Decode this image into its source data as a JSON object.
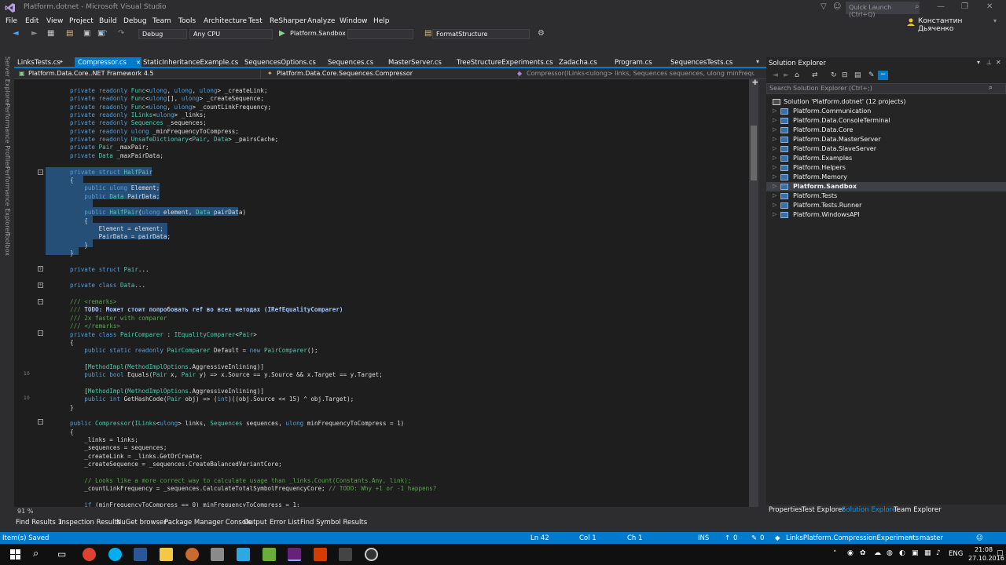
{
  "window": {
    "title": "Platform.dotnet - Microsoft Visual Studio",
    "quick_launch": "Quick Launch (Ctrl+Q)",
    "user": "Константин Дьяченко"
  },
  "menu": [
    "File",
    "Edit",
    "View",
    "Project",
    "Build",
    "Debug",
    "Team",
    "Tools",
    "Architecture",
    "Test",
    "ReSharper",
    "Analyze",
    "Window",
    "Help"
  ],
  "toolbar": {
    "config": "Debug",
    "platform": "Any CPU",
    "start": "Platform.Sandbox",
    "format": "FormatStructure"
  },
  "left_strip": [
    "Server Explorer",
    "Performance Profiler",
    "Performance Explorer",
    "Toolbox"
  ],
  "tabs": [
    {
      "label": "LinksTests.cs",
      "active": false
    },
    {
      "label": "Compressor.cs",
      "active": true
    },
    {
      "label": "StaticInheritanceExample.cs",
      "active": false
    },
    {
      "label": "SequencesOptions.cs",
      "active": false
    },
    {
      "label": "Sequences.cs",
      "active": false
    },
    {
      "label": "MasterServer.cs",
      "active": false
    },
    {
      "label": "TreeStructureExperiments.cs",
      "active": false
    },
    {
      "label": "Zadacha.cs",
      "active": false
    },
    {
      "label": "Program.cs",
      "active": false
    },
    {
      "label": "SequencesTests.cs",
      "active": false
    }
  ],
  "navbar": {
    "project": "Platform.Data.Core..NET Framework 4.5",
    "type": "Platform.Data.Core.Sequences.Compressor",
    "member": "Compressor(ILinks<ulong> links, Sequences sequences, ulong minFrequencyToCo"
  },
  "code": {
    "lines": [
      "private readonly Func<ulong, ulong, ulong> _createLink;",
      "private readonly Func<ulong[], ulong> _createSequence;",
      "private readonly Func<ulong, ulong> _countLinkFrequency;",
      "private readonly ILinks<ulong> _links;",
      "private readonly Sequences _sequences;",
      "private readonly ulong _minFrequencyToCompress;",
      "private readonly UnsafeDictionary<Pair, Data> _pairsCache;",
      "private Pair _maxPair;",
      "private Data _maxPairData;",
      "",
      "private struct HalfPair",
      "{",
      "    public ulong Element;",
      "    public Data PairData;",
      "",
      "    public HalfPair(ulong element, Data pairData)",
      "    {",
      "        Element = element;",
      "        PairData = pairData;",
      "    }",
      "}",
      "",
      "private struct Pair...",
      "",
      "private class Data...",
      "",
      "/// <remarks>",
      "/// TODO: Может стоит попробовать ref во всех методах (IRefEqualityComparer)",
      "/// 2x faster with comparer",
      "/// </remarks>",
      "private class PairComparer : IEqualityComparer<Pair>",
      "{",
      "    public static readonly PairComparer Default = new PairComparer();",
      "",
      "    [MethodImpl(MethodImplOptions.AggressiveInlining)]",
      "    public bool Equals(Pair x, Pair y) => x.Source == y.Source && x.Target == y.Target;",
      "",
      "    [MethodImpl(MethodImplOptions.AggressiveInlining)]",
      "    public int GetHashCode(Pair obj) => (int)((obj.Source << 15) ^ obj.Target);",
      "}",
      "",
      "public Compressor(ILinks<ulong> links, Sequences sequences, ulong minFrequencyToCompress = 1)",
      "{",
      "    _links = links;",
      "    _sequences = sequences;",
      "    _createLink = _links.GetOrCreate;",
      "    _createSequence = _sequences.CreateBalancedVariantCore;",
      "",
      "    // Looks like a more correct way to calculate usage than _links.Count(Constants.Any, link);",
      "    _countLinkFrequency = _sequences.CalculateTotalSymbolFrequencyCore; // TODO: Why +1 or -1 happens?",
      "",
      "    if (minFrequencyToCompress == 0) minFrequencyToCompress = 1;"
    ]
  },
  "zoom": "91 %",
  "solution_explorer": {
    "title": "Solution Explorer",
    "search_placeholder": "Search Solution Explorer (Ctrl+;)",
    "solution": "Solution 'Platform.dotnet' (12 projects)",
    "projects": [
      "Platform.Communication",
      "Platform.Data.ConsoleTerminal",
      "Platform.Data.Core",
      "Platform.Data.MasterServer",
      "Platform.Data.SlaveServer",
      "Platform.Examples",
      "Platform.Helpers",
      "Platform.Memory",
      "Platform.Sandbox",
      "Platform.Tests",
      "Platform.Tests.Runner",
      "Platform.WindowsAPI"
    ],
    "selected": "Platform.Sandbox",
    "bottom_tabs": [
      "Properties",
      "Test Explorer",
      "Solution Explorer",
      "Team Explorer"
    ]
  },
  "bottom_tabs": [
    "Find Results 1",
    "Inspection Results",
    "NuGet browser",
    "Package Manager Console",
    "Output",
    "Error List",
    "Find Symbol Results"
  ],
  "status": {
    "message": "Item(s) Saved",
    "ln": "Ln 42",
    "col": "Col 1",
    "ch": "Ch 1",
    "ins": "INS",
    "up": "0",
    "changes": "0",
    "repo": "LinksPlatform.CompressionExperiments",
    "branch": "master"
  },
  "taskbar": {
    "lang": "ENG",
    "time": "21:08",
    "date": "27.10.2016"
  }
}
